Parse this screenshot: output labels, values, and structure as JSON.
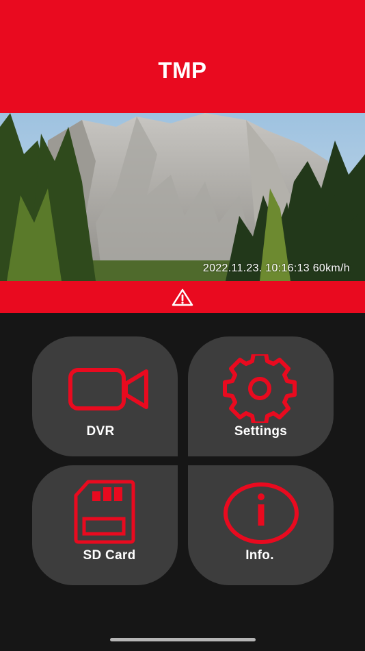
{
  "header": {
    "title": "TMP"
  },
  "preview": {
    "overlay": "2022.11.23.  10:16:13 60km/h"
  },
  "alert": {
    "icon": "warning-triangle-icon"
  },
  "menu": {
    "dvr": {
      "label": "DVR",
      "icon": "video-camera-icon"
    },
    "settings": {
      "label": "Settings",
      "icon": "gear-icon"
    },
    "sd_card": {
      "label": "SD Card",
      "icon": "sd-card-icon"
    },
    "info": {
      "label": "Info.",
      "icon": "info-icon"
    }
  },
  "colors": {
    "accent": "#e90a1f",
    "tile": "#3d3d3d",
    "background": "#161616"
  }
}
